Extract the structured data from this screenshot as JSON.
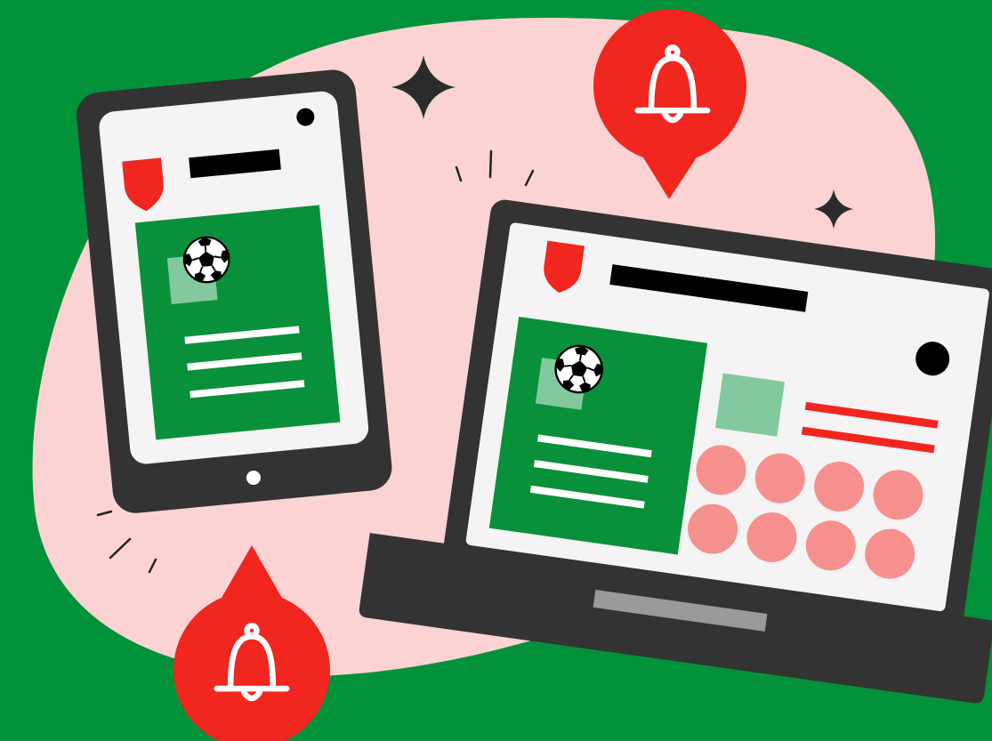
{
  "illustration": {
    "colors": {
      "background": "#02923A",
      "blob": "#FBD3D3",
      "device_frame": "#333333",
      "screen": "#F5F3F3",
      "card_green": "#08913A",
      "light_green": "#84C99E",
      "alert_red": "#F0261F",
      "soft_red": "#F6908E",
      "white": "#FFFFFF",
      "black": "#000000",
      "trackpad": "#9A9A9A",
      "star": "#2B2B2B"
    },
    "icons": {
      "tablet_shield": "shield-icon",
      "laptop_shield": "shield-icon",
      "ball": "soccer-ball-icon",
      "notification": "bell-icon",
      "sparkle": "sparkle-star-icon"
    }
  }
}
